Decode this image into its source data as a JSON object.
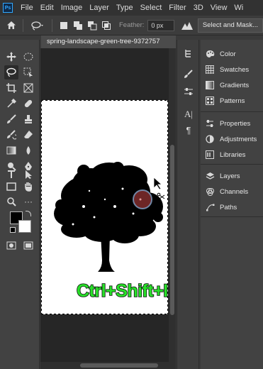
{
  "menubar": {
    "logo": "Ps",
    "items": [
      "File",
      "Edit",
      "Image",
      "Layer",
      "Type",
      "Select",
      "Filter",
      "3D",
      "View",
      "Wi"
    ]
  },
  "options": {
    "feather_label": "Feather:",
    "feather_value": "0 px",
    "select_mask_label": "Select and Mask..."
  },
  "document": {
    "tab_title": "spring-landscape-green-tree-9372757"
  },
  "overlay": {
    "shortcut_text": "Ctrl+Shift+I"
  },
  "panels": {
    "group1": [
      "Color",
      "Swatches",
      "Gradients",
      "Patterns"
    ],
    "group2": [
      "Properties",
      "Adjustments",
      "Libraries"
    ],
    "group3": [
      "Layers",
      "Channels",
      "Paths"
    ]
  },
  "colors": {
    "foreground": "#000000",
    "background": "#ffffff",
    "shortcut_text": "#29e02a"
  }
}
